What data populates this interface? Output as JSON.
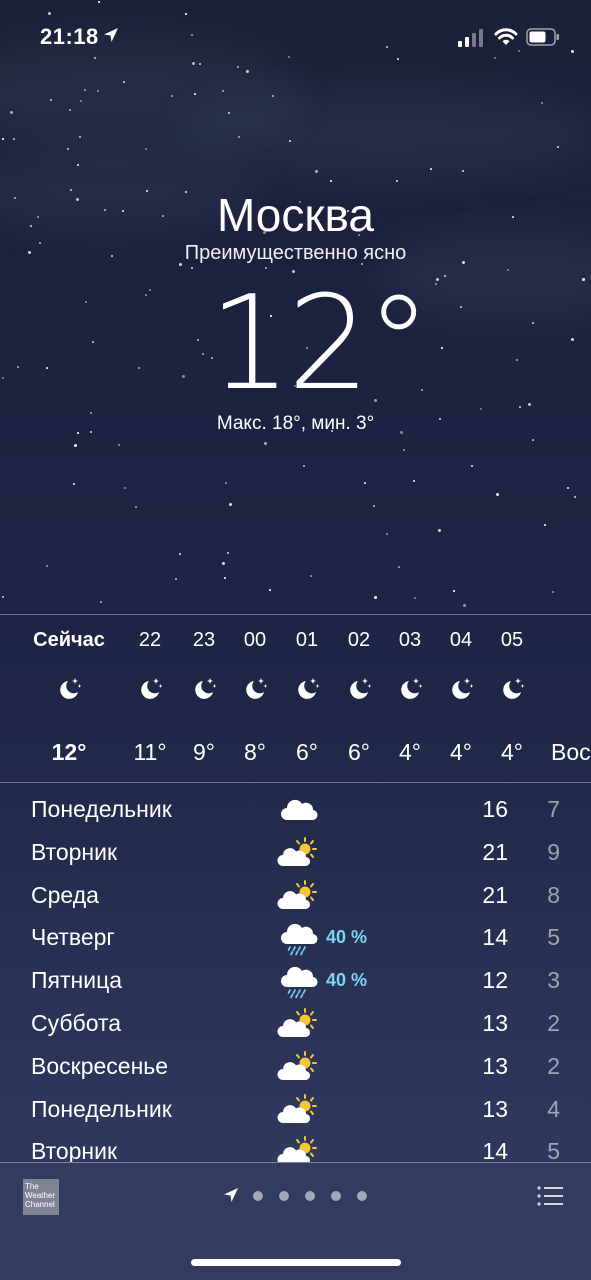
{
  "status_bar": {
    "time": "21:18",
    "location_icon": "location-arrow-icon",
    "signal_icon": "cellular-signal-icon",
    "wifi_icon": "wifi-icon",
    "battery_icon": "battery-icon"
  },
  "header": {
    "city": "Москва",
    "condition": "Преимущественно ясно",
    "temperature": "12°",
    "high_low": "Макс. 18°, мин. 3°"
  },
  "hourly": [
    {
      "label": "Сейчас",
      "icon": "moon-stars-icon",
      "temp": "12°"
    },
    {
      "label": "22",
      "icon": "moon-stars-icon",
      "temp": "11°"
    },
    {
      "label": "23",
      "icon": "moon-stars-icon",
      "temp": "9°"
    },
    {
      "label": "00",
      "icon": "moon-stars-icon",
      "temp": "8°"
    },
    {
      "label": "01",
      "icon": "moon-stars-icon",
      "temp": "6°"
    },
    {
      "label": "02",
      "icon": "moon-stars-icon",
      "temp": "6°"
    },
    {
      "label": "03",
      "icon": "moon-stars-icon",
      "temp": "4°"
    },
    {
      "label": "04",
      "icon": "moon-stars-icon",
      "temp": "4°"
    },
    {
      "label": "05",
      "icon": "moon-stars-icon",
      "temp": "4°"
    },
    {
      "label": "",
      "icon": "",
      "temp": "Вос"
    }
  ],
  "daily": [
    {
      "day": "Понедельник",
      "icon": "cloud-icon",
      "precip": "",
      "max": "16",
      "min": "7"
    },
    {
      "day": "Вторник",
      "icon": "partly-sunny-icon",
      "precip": "",
      "max": "21",
      "min": "9"
    },
    {
      "day": "Среда",
      "icon": "partly-sunny-icon",
      "precip": "",
      "max": "21",
      "min": "8"
    },
    {
      "day": "Четверг",
      "icon": "cloud-rain-icon",
      "precip": "40 %",
      "max": "14",
      "min": "5"
    },
    {
      "day": "Пятница",
      "icon": "cloud-rain-icon",
      "precip": "40 %",
      "max": "12",
      "min": "3"
    },
    {
      "day": "Суббота",
      "icon": "partly-sunny-icon",
      "precip": "",
      "max": "13",
      "min": "2"
    },
    {
      "day": "Воскресенье",
      "icon": "partly-sunny-icon",
      "precip": "",
      "max": "13",
      "min": "2"
    },
    {
      "day": "Понедельник",
      "icon": "partly-sunny-icon",
      "precip": "",
      "max": "13",
      "min": "4"
    },
    {
      "day": "Вторник",
      "icon": "partly-sunny-icon",
      "precip": "",
      "max": "14",
      "min": "5"
    }
  ],
  "bottom_bar": {
    "weather_channel_logo": "The Weather Channel",
    "page_count": 5,
    "current_page": "location",
    "list_icon": "list-icon"
  },
  "colors": {
    "precip_text": "#7dd3f5",
    "sun": "#f6c533",
    "bottom_bar_bg": "#333c60"
  }
}
